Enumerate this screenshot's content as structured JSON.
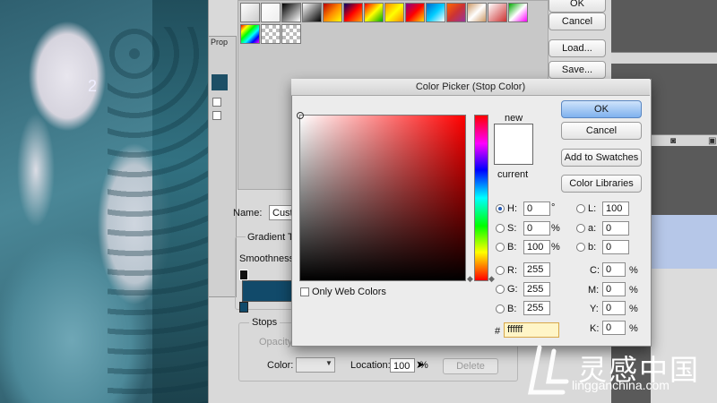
{
  "photo": {
    "label": "woman with hand on mouth",
    "overlay_number": "2"
  },
  "gradient_editor": {
    "side_buttons": {
      "ok": "OK",
      "cancel": "Cancel",
      "load": "Load...",
      "save": "Save..."
    },
    "name_label": "Name:",
    "name_value": "Custo",
    "gradient_type_label": "Gradient Ty",
    "smoothness_label": "Smoothness:",
    "stops_label": "Stops",
    "opacity_label": "Opacity:",
    "color_label": "Color:",
    "location_label": "Location:",
    "location_value": "100",
    "location_unit": "%",
    "delete_label": "Delete",
    "props_label": "Prop",
    "bar_color": "#114a6a"
  },
  "color_picker": {
    "title": "Color Picker (Stop Color)",
    "new_label": "new",
    "current_label": "current",
    "buttons": {
      "ok": "OK",
      "cancel": "Cancel",
      "add_to_swatches": "Add to Swatches",
      "color_libraries": "Color Libraries"
    },
    "only_web_colors_label": "Only Web Colors",
    "hsb": [
      {
        "label": "H:",
        "value": "0",
        "unit": "°",
        "selected": true
      },
      {
        "label": "S:",
        "value": "0",
        "unit": "%",
        "selected": false
      },
      {
        "label": "B:",
        "value": "100",
        "unit": "%",
        "selected": false
      }
    ],
    "rgb": [
      {
        "label": "R:",
        "value": "255"
      },
      {
        "label": "G:",
        "value": "255"
      },
      {
        "label": "B:",
        "value": "255"
      }
    ],
    "lab": [
      {
        "label": "L:",
        "value": "100"
      },
      {
        "label": "a:",
        "value": "0"
      },
      {
        "label": "b:",
        "value": "0"
      }
    ],
    "cmyk": [
      {
        "label": "C:",
        "value": "0",
        "unit": "%"
      },
      {
        "label": "M:",
        "value": "0",
        "unit": "%"
      },
      {
        "label": "Y:",
        "value": "0",
        "unit": "%"
      },
      {
        "label": "K:",
        "value": "0",
        "unit": "%"
      }
    ],
    "hex_label": "#",
    "hex_value": "ffffff",
    "new_color": "#ffffff",
    "current_color": "#ffffff"
  },
  "watermark": {
    "brand": "灵感中国",
    "url": "lingganchina.com"
  }
}
